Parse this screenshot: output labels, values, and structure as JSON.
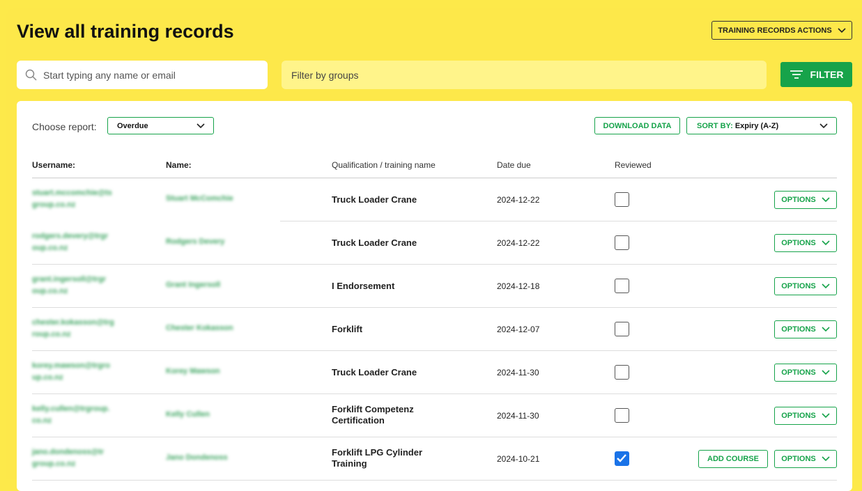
{
  "header": {
    "title": "View all training records",
    "actions_label": "TRAINING RECORDS ACTIONS"
  },
  "search": {
    "placeholder": "Start typing any name or email"
  },
  "groups_filter": {
    "placeholder": "Filter by groups"
  },
  "filter_button": {
    "label": "FILTER"
  },
  "report": {
    "choose_label": "Choose report:",
    "selected": "Overdue",
    "download_label": "DOWNLOAD DATA",
    "sort_key": "SORT BY:",
    "sort_value": "Expiry (A-Z)"
  },
  "table": {
    "columns": [
      "Username:",
      "Name:",
      "Qualification / training name",
      "Date due",
      "Reviewed"
    ],
    "option_label": "OPTIONS",
    "add_course_label": "ADD COURSE",
    "rows": [
      {
        "username": "stuart.mccomchie@ts group.co.nz",
        "name": "Stuart McComchie",
        "qualification": "Truck Loader Crane",
        "date": "2024-12-22",
        "reviewed": false,
        "add_course": false
      },
      {
        "username": "rodgers.devery@trgr oup.co.nz",
        "name": "Rodgers Devery",
        "qualification": "Truck Loader Crane",
        "date": "2024-12-22",
        "reviewed": false,
        "add_course": false
      },
      {
        "username": "grant.ingersoll@trgr oup.co.nz",
        "name": "Grant Ingersoll",
        "qualification": "I Endorsement",
        "date": "2024-12-18",
        "reviewed": false,
        "add_course": false
      },
      {
        "username": "chester.kokasson@trg roup.co.nz",
        "name": "Chester Kokasson",
        "qualification": "Forklift",
        "date": "2024-12-07",
        "reviewed": false,
        "add_course": false
      },
      {
        "username": "korey.mawson@trgro up.co.nz",
        "name": "Korey Mawson",
        "qualification": "Truck Loader Crane",
        "date": "2024-11-30",
        "reviewed": false,
        "add_course": false
      },
      {
        "username": "kelly.cullen@trgroup. co.nz",
        "name": "Kelly Cullen",
        "qualification": "Forklift Competenz Certification",
        "date": "2024-11-30",
        "reviewed": false,
        "add_course": false
      },
      {
        "username": "jano.dondenoss@tr group.co.nz",
        "name": "Jano Dondenoss",
        "qualification": "Forklift LPG Cylinder Training",
        "date": "2024-10-21",
        "reviewed": true,
        "add_course": true
      }
    ]
  },
  "colors": {
    "background": "#fde84a",
    "accent": "#16a34a",
    "checked": "#1a73e8"
  }
}
